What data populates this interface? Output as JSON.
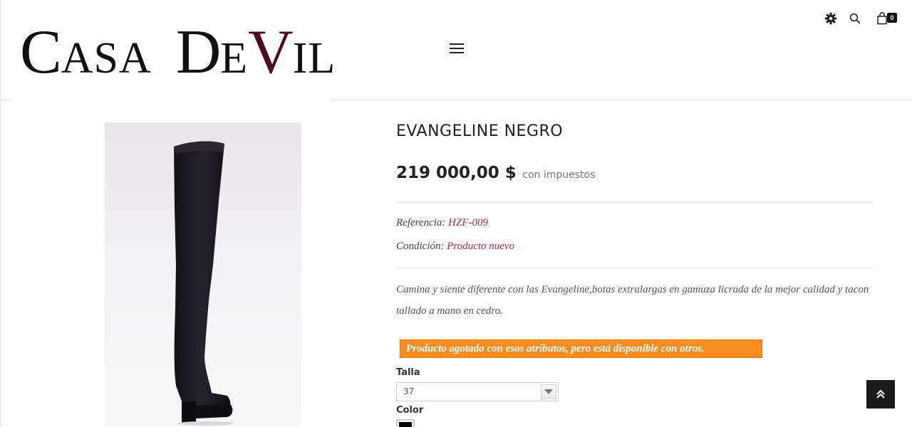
{
  "header": {
    "logo": {
      "part1_big": "C",
      "part1_small": "ASA",
      "part2_big": "D",
      "part2_small_e": "E",
      "part2_accent": "V",
      "part2_small_rest": "IL"
    },
    "cart_count": "0",
    "icons": [
      "settings-icon",
      "search-icon",
      "cart-icon",
      "menu-icon"
    ]
  },
  "product": {
    "title": "EVANGELINE NEGRO",
    "price": "219 000,00 $",
    "tax_note": "con impuestos",
    "reference_label": "Referencia:",
    "reference_value": "HZF-009",
    "condition_label": "Condición:",
    "condition_value": "Producto nuevo",
    "description": "Camina y siente diferente con las Evangeline,botas extralargas en gamuza licrada de la mejor calidad y tacon tallado a mano en cedro.",
    "availability_alert": "Producto agotado con esos atributos, pero está disponible con otros.",
    "size_label": "Talla",
    "size_value": "37",
    "color_label": "Color",
    "color_swatch": "#000000"
  },
  "colors": {
    "accent": "#b0235a",
    "logo_accent": "#4a0f23",
    "alert": "#f88e22",
    "back_to_top": "#1c1c1c"
  }
}
